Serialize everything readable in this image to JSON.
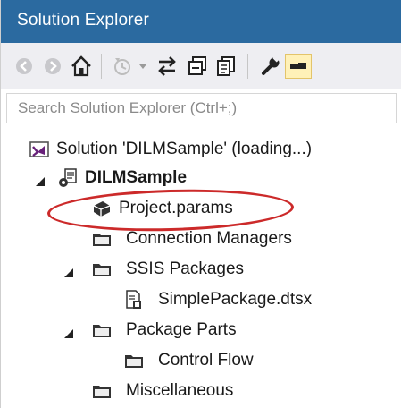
{
  "window": {
    "title": "Solution Explorer"
  },
  "toolbar": {
    "buttons": [
      {
        "icon": "back-icon"
      },
      {
        "icon": "forward-icon"
      },
      {
        "icon": "home-icon"
      },
      {
        "icon": "pending-changes-filter-icon"
      },
      {
        "icon": "sync-with-active-document-icon"
      },
      {
        "icon": "collapse-all-icon"
      },
      {
        "icon": "show-all-files-icon"
      },
      {
        "icon": "properties-icon"
      },
      {
        "icon": "preview-selected-items-icon"
      }
    ]
  },
  "search": {
    "placeholder": "Search Solution Explorer (Ctrl+;)"
  },
  "tree": {
    "items": [
      {
        "label": "Solution 'DILMSample' (loading...)",
        "icon": "solution-icon",
        "expander": ""
      },
      {
        "label": "DILMSample",
        "icon": "ssis-project-icon",
        "expander": "expanded"
      },
      {
        "label": "Project.params",
        "icon": "params-icon",
        "expander": ""
      },
      {
        "label": "Connection Managers",
        "icon": "folder-icon",
        "expander": ""
      },
      {
        "label": "SSIS Packages",
        "icon": "folder-icon",
        "expander": "expanded"
      },
      {
        "label": "SimplePackage.dtsx",
        "icon": "package-icon",
        "expander": ""
      },
      {
        "label": "Package Parts",
        "icon": "folder-icon",
        "expander": "expanded"
      },
      {
        "label": "Control Flow",
        "icon": "folder-icon",
        "expander": ""
      },
      {
        "label": "Miscellaneous",
        "icon": "folder-icon",
        "expander": ""
      }
    ]
  },
  "colors": {
    "titlebar": "#2b6aa0",
    "highlight_annotation": "#cc2a2a"
  }
}
